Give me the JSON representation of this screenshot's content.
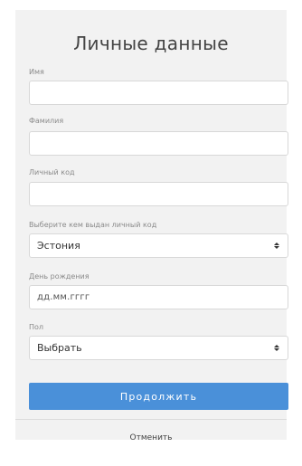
{
  "form": {
    "title": "Личные данные",
    "first_name": {
      "label": "Имя",
      "value": ""
    },
    "last_name": {
      "label": "Фамилия",
      "value": ""
    },
    "personal_code": {
      "label": "Личный код",
      "value": ""
    },
    "issuer": {
      "label": "Выберите кем выдан личный код",
      "selected": "Эстония"
    },
    "birth_date": {
      "label": "День рождения",
      "placeholder": "дд.мм.гггг"
    },
    "gender": {
      "label": "Пол",
      "selected": "Выбрать"
    },
    "continue_label": "Продолжить",
    "cancel_label": "Отменить"
  }
}
